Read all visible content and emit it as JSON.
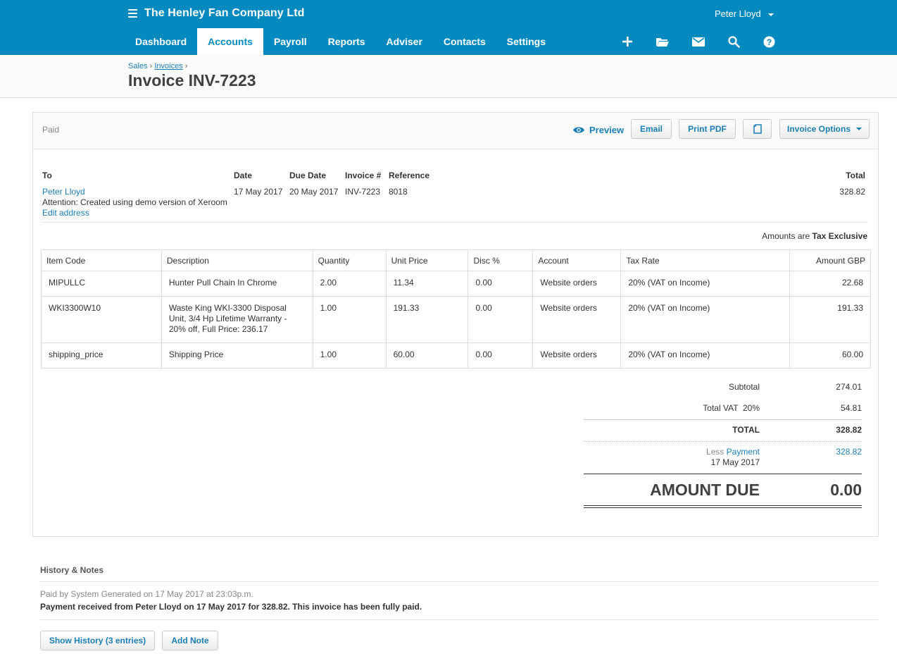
{
  "app": {
    "org_name": "The Henley Fan Company Ltd",
    "user_name": "Peter Lloyd",
    "nav": [
      "Dashboard",
      "Accounts",
      "Payroll",
      "Reports",
      "Adviser",
      "Contacts",
      "Settings"
    ],
    "active_nav": "Accounts",
    "icons": [
      "plus-icon",
      "folder-icon",
      "mail-icon",
      "search-icon",
      "help-icon"
    ],
    "accent": "#048abf"
  },
  "breadcrumb": {
    "sales": "Sales",
    "invoices": "Invoices",
    "sep": "›"
  },
  "page_title": "Invoice INV-7223",
  "toolbar": {
    "status": "Paid",
    "preview": "Preview",
    "email": "Email",
    "print_pdf": "Print PDF",
    "invoice_options": "Invoice Options"
  },
  "invoice_header": {
    "to_label": "To",
    "date_label": "Date",
    "due_label": "Due Date",
    "number_label": "Invoice #",
    "reference_label": "Reference",
    "total_label": "Total",
    "contact": "Peter Lloyd",
    "attention": "Attention: Created using demo version of Xeroom",
    "edit_address": "Edit address",
    "date": "17 May 2017",
    "due_date": "20 May 2017",
    "number": "INV-7223",
    "reference": "8018",
    "total": "328.82",
    "amounts_prefix": "Amounts are",
    "amounts_type": "Tax Exclusive"
  },
  "table": {
    "columns": [
      "Item Code",
      "Description",
      "Quantity",
      "Unit Price",
      "Disc %",
      "Account",
      "Tax Rate",
      "Amount GBP"
    ],
    "rows": [
      [
        "MIPULLC",
        "Hunter Pull Chain In Chrome",
        "2.00",
        "11.34",
        "0.00",
        "Website orders",
        "20% (VAT on Income)",
        "22.68"
      ],
      [
        "WKI3300W10",
        "Waste King WKI-3300 Disposal Unit, 3/4 Hp Lifetime Warranty - 20% off, Full Price: 236.17",
        "1.00",
        "191.33",
        "0.00",
        "Website orders",
        "20% (VAT on Income)",
        "191.33"
      ],
      [
        "shipping_price",
        "Shipping Price",
        "1.00",
        "60.00",
        "0.00",
        "Website orders",
        "20% (VAT on Income)",
        "60.00"
      ]
    ]
  },
  "totals": {
    "subtotal_label": "Subtotal",
    "subtotal": "274.01",
    "vat_label": "Total VAT  20%",
    "vat": "54.81",
    "total_label": "TOTAL",
    "total": "328.82",
    "less_label": "Less",
    "payment_link": "Payment",
    "payment_date": "17 May 2017",
    "payment_amount": "328.82",
    "amount_due_label": "AMOUNT DUE",
    "amount_due": "0.00"
  },
  "history": {
    "title": "History & Notes",
    "meta": "Paid by System Generated on 17 May 2017 at 23:03p.m.",
    "text": "Payment received from Peter Lloyd on 17 May 2017 for 328.82. This invoice has been fully paid.",
    "show_history": "Show History (3 entries)",
    "add_note": "Add Note"
  }
}
